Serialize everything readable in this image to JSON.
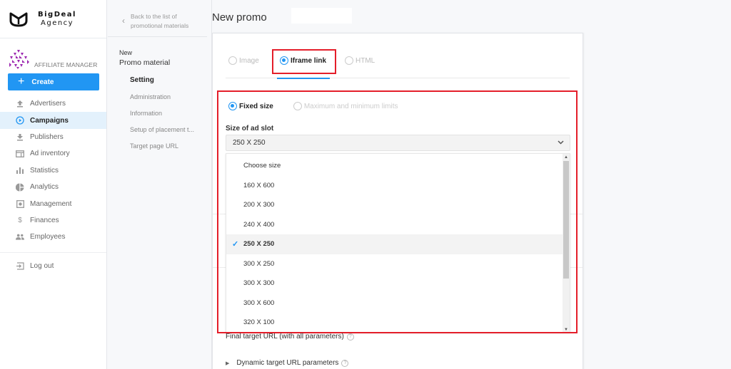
{
  "brand": {
    "line1": "BigDeal",
    "line2": "Agency"
  },
  "role": {
    "label": "AFFILIATE MANAGER"
  },
  "sidebar": {
    "create_label": "Create",
    "items": [
      {
        "label": "Advertisers",
        "icon": "upload-icon"
      },
      {
        "label": "Campaigns",
        "icon": "play-circle-icon",
        "active": true
      },
      {
        "label": "Publishers",
        "icon": "download-icon"
      },
      {
        "label": "Ad inventory",
        "icon": "window-icon"
      },
      {
        "label": "Statistics",
        "icon": "bar-chart-icon"
      },
      {
        "label": "Analytics",
        "icon": "pie-chart-icon"
      },
      {
        "label": "Management",
        "icon": "settings-box-icon"
      },
      {
        "label": "Finances",
        "icon": "dollar-icon"
      },
      {
        "label": "Employees",
        "icon": "people-icon"
      }
    ],
    "logout_label": "Log out"
  },
  "subnav": {
    "back_line1": "Back to the list of",
    "back_line2": "promotional materials",
    "title_small": "New",
    "title_big": "Promo material",
    "items": [
      {
        "label": "Setting",
        "active": true
      },
      {
        "label": "Administration"
      },
      {
        "label": "Information"
      },
      {
        "label": "Setup of placement t..."
      },
      {
        "label": "Target page URL"
      }
    ]
  },
  "main": {
    "page_title": "New promo",
    "type_options": [
      {
        "label": "Image",
        "selected": false
      },
      {
        "label": "Iframe link",
        "selected": true
      },
      {
        "label": "HTML",
        "selected": false
      }
    ],
    "size_modes": [
      {
        "label": "Fixed size",
        "selected": true
      },
      {
        "label": "Maximum and minimum limits",
        "selected": false
      }
    ],
    "ad_slot_label": "Size of ad slot",
    "ad_slot_value": "250 X 250",
    "ad_slot_options": [
      "Choose size",
      "160 X 600",
      "200 X 300",
      "240 X 400",
      "250 X 250",
      "300 X 250",
      "300 X 300",
      "300 X 600",
      "320 X 100"
    ],
    "selected_option_index": 4,
    "final_url_label": "Final target URL (with all parameters)",
    "dynamic_params_label": "Dynamic target URL parameters"
  },
  "colors": {
    "accent": "#2196f3",
    "highlight": "#e41e2a",
    "active_bg": "#e3f1fc"
  }
}
